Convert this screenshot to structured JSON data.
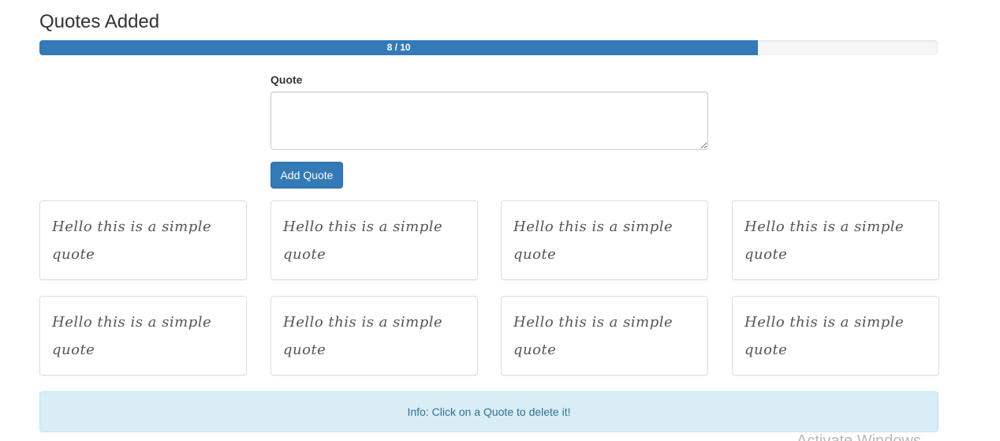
{
  "header": {
    "title": "Quotes Added"
  },
  "progress": {
    "label": "8 / 10",
    "current": 8,
    "max": 10,
    "fraction": 0.8
  },
  "form": {
    "quote_label": "Quote",
    "quote_value": "",
    "add_button_label": "Add Quote"
  },
  "quotes": [
    {
      "text": "Hello this is a simple quote"
    },
    {
      "text": "Hello this is a simple quote"
    },
    {
      "text": "Hello this is a simple quote"
    },
    {
      "text": "Hello this is a simple quote"
    },
    {
      "text": "Hello this is a simple quote"
    },
    {
      "text": "Hello this is a simple quote"
    },
    {
      "text": "Hello this is a simple quote"
    },
    {
      "text": "Hello this is a simple quote"
    }
  ],
  "info": {
    "text": "Info: Click on a Quote to delete it!"
  },
  "overlay": {
    "watermark": "Activate Windows"
  },
  "colors": {
    "primary": "#337ab7",
    "info_bg": "#d9edf7",
    "info_text": "#31708f"
  }
}
